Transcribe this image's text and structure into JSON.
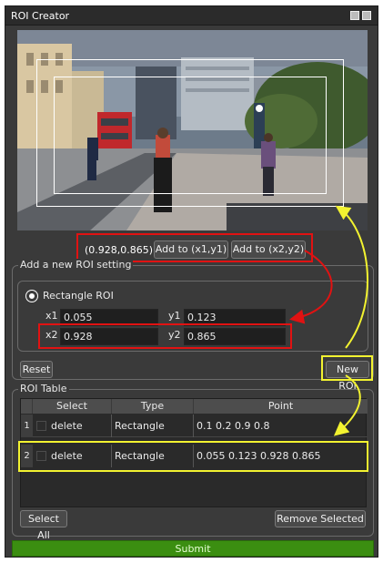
{
  "window": {
    "title": "ROI Creator"
  },
  "preview": {
    "coord_readout": "(0.928,0.865)",
    "add_xy1_label": "Add to (x1,y1)",
    "add_xy2_label": "Add to (x2,y2)"
  },
  "roi_setting": {
    "group_title": "Add a new ROI setting",
    "shape_label": "Rectangle ROI",
    "x1_label": "x1",
    "x1_value": "0.055",
    "y1_label": "y1",
    "y1_value": "0.123",
    "x2_label": "x2",
    "x2_value": "0.928",
    "y2_label": "y2",
    "y2_value": "0.865",
    "reset_label": "Reset",
    "new_roi_label": "New ROI"
  },
  "roi_table": {
    "group_title": "ROI Table",
    "headers": [
      "Select",
      "Type",
      "Point"
    ],
    "rows": [
      {
        "num": "1",
        "select": "delete",
        "type": "Rectangle",
        "point": "0.1 0.2 0.9 0.8"
      },
      {
        "num": "2",
        "select": "delete",
        "type": "Rectangle",
        "point": "0.055 0.123 0.928 0.865"
      }
    ],
    "select_all_label": "Select All",
    "remove_selected_label": "Remove Selected"
  },
  "submit_label": "Submit",
  "colors": {
    "annotation_red": "#e11212",
    "annotation_yellow": "#f2f230",
    "submit_green": "#3b8e11"
  }
}
